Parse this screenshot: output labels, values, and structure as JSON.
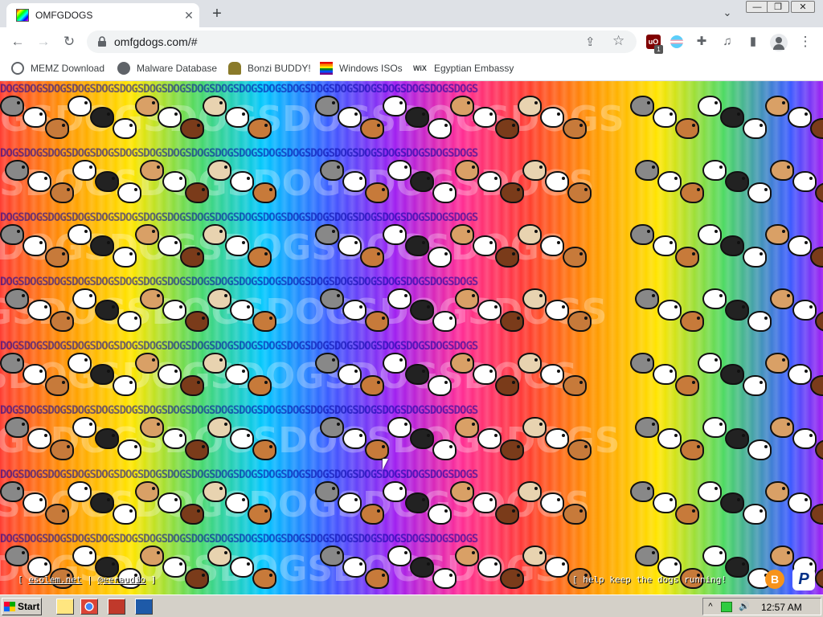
{
  "browser": {
    "tab_title": "OMFGDOGS",
    "url": "omfgdogs.com/#",
    "tab_close_glyph": "✕",
    "new_tab_glyph": "+",
    "window_controls": {
      "minimize": "—",
      "maximize": "❐",
      "close": "✕"
    }
  },
  "toolbar": {
    "back_glyph": "←",
    "forward_glyph": "→",
    "reload_glyph": "↻",
    "menu_glyph": "⋮",
    "ublock_badge": "1"
  },
  "bookmarks": [
    {
      "label": "MEMZ Download",
      "icon": "globe-icon"
    },
    {
      "label": "Malware Database",
      "icon": "globe-icon"
    },
    {
      "label": "Bonzi BUDDY!",
      "icon": "bonzi-icon"
    },
    {
      "label": "Windows ISOs",
      "icon": "rainbow-flag-icon"
    },
    {
      "label": "Egyptian Embassy",
      "icon": "wix-icon"
    }
  ],
  "page": {
    "footer_left_prefix": "[",
    "footer_left_link1": "esolem.net",
    "footer_left_sep": "|",
    "footer_left_link2": "@eeraudio",
    "footer_left_suffix": "]",
    "footer_right": "[ help keep the dogs running!",
    "bitcoin_glyph": "B",
    "paypal_glyph": "P",
    "repeating_word": "DOGSDOGSDOGSDOGSDOGSDOGSDOGSDOGSDOGSDOGSDOGSDOGSDOGSDOGSDOGSDOGSDOGSDOGSDOGSDOGS",
    "big_letters": "GSDOGSDOGSDOGSDOGSDOGS"
  },
  "taskbar": {
    "start_label": "Start",
    "clock": "12:57 AM",
    "tray_up": "^",
    "volume_glyph": "🔊"
  },
  "colors": {
    "tab_bar": "#dee1e6",
    "taskbar": "#d4d0c8",
    "bitcoin": "#f7931a",
    "paypal": "#003087"
  }
}
